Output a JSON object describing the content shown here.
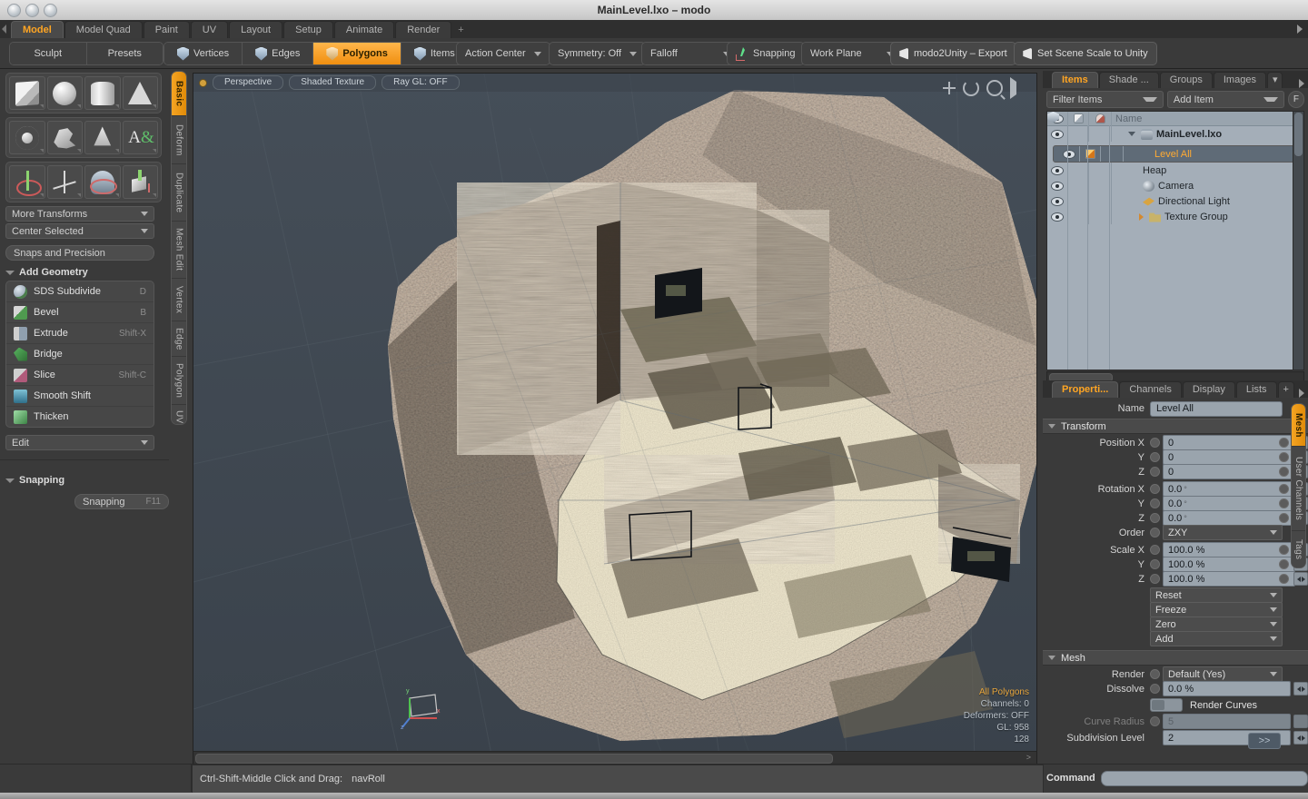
{
  "window": {
    "title": "MainLevel.lxo – modo",
    "traffic_lights": [
      "close",
      "minimize",
      "zoom"
    ]
  },
  "layout_tabs": {
    "items": [
      {
        "label": "Model",
        "active": true
      },
      {
        "label": "Model Quad",
        "active": false
      },
      {
        "label": "Paint",
        "active": false
      },
      {
        "label": "UV",
        "active": false
      },
      {
        "label": "Layout",
        "active": false
      },
      {
        "label": "Setup",
        "active": false
      },
      {
        "label": "Animate",
        "active": false
      },
      {
        "label": "Render",
        "active": false
      }
    ],
    "add_label": "+"
  },
  "toolbar": {
    "sculpt": "Sculpt",
    "presets": "Presets",
    "selection_modes": [
      {
        "label": "Vertices",
        "active": false
      },
      {
        "label": "Edges",
        "active": false
      },
      {
        "label": "Polygons",
        "active": true
      },
      {
        "label": "Items",
        "active": false
      }
    ],
    "action_center": "Action Center",
    "symmetry": "Symmetry: Off",
    "falloff": "Falloff",
    "snapping": "Snapping",
    "work_plane": "Work Plane",
    "modo2unity_export": "modo2Unity – Export",
    "set_scene_scale": "Set Scene Scale to Unity"
  },
  "left_panel": {
    "primitive_icons": [
      "cube-icon",
      "sphere-icon",
      "cylinder-icon",
      "cone-icon",
      "torus-icon",
      "spline-icon",
      "bell-curve-icon",
      "text-icon",
      "transform-gizmo-icon",
      "move-gizmo-icon",
      "rotate-gizmo-icon",
      "scale-gizmo-icon"
    ],
    "more_transforms": "More Transforms",
    "center_selected": "Center Selected",
    "snaps_and_precision": "Snaps and Precision",
    "add_geometry_header": "Add Geometry",
    "tools": [
      {
        "label": "SDS Subdivide",
        "shortcut": "D",
        "icon": "sds-subdivide-icon"
      },
      {
        "label": "Bevel",
        "shortcut": "B",
        "icon": "bevel-icon"
      },
      {
        "label": "Extrude",
        "shortcut": "Shift-X",
        "icon": "extrude-icon"
      },
      {
        "label": "Bridge",
        "shortcut": "",
        "icon": "bridge-icon"
      },
      {
        "label": "Slice",
        "shortcut": "Shift-C",
        "icon": "slice-icon"
      },
      {
        "label": "Smooth Shift",
        "shortcut": "",
        "icon": "smooth-shift-icon"
      },
      {
        "label": "Thicken",
        "shortcut": "",
        "icon": "thicken-icon"
      }
    ],
    "edit_dropdown": "Edit",
    "snapping_header": "Snapping",
    "snapping_button": "Snapping",
    "snapping_shortcut": "F11",
    "rail_tabs": [
      {
        "label": "Basic",
        "active": true
      },
      {
        "label": "Deform",
        "active": false
      },
      {
        "label": "Duplicate",
        "active": false
      },
      {
        "label": "Mesh Edit",
        "active": false
      },
      {
        "label": "Vertex",
        "active": false
      },
      {
        "label": "Edge",
        "active": false
      },
      {
        "label": "Polygon",
        "active": false
      },
      {
        "label": "UV",
        "active": false
      }
    ]
  },
  "viewport": {
    "view_mode": "Perspective",
    "shading_mode": "Shaded Texture",
    "raygl": "Ray GL: OFF",
    "controls": [
      "pan-icon",
      "rotate-icon",
      "zoom-icon",
      "play-icon"
    ],
    "info": {
      "selection": "All Polygons",
      "channels": "Channels: 0",
      "deformers": "Deformers: OFF",
      "gl": "GL: 958",
      "extra": "128"
    },
    "axis_labels": {
      "x": "x",
      "y": "y",
      "z": "z"
    }
  },
  "right_panel": {
    "top_tabs": [
      {
        "label": "Items",
        "active": true
      },
      {
        "label": "Shade ...",
        "active": false
      },
      {
        "label": "Groups",
        "active": false
      },
      {
        "label": "Images",
        "active": false
      }
    ],
    "filter_items": "Filter Items",
    "add_item": "Add Item",
    "filter_button": "F",
    "column_header_name": "Name",
    "tree": [
      {
        "name": "MainLevel.lxo",
        "indent": 0,
        "icon": "scene-icon",
        "twisty": "down",
        "selected": false
      },
      {
        "name": "Level All",
        "indent": 1,
        "icon": "mesh-icon",
        "twisty": "none",
        "selected": true
      },
      {
        "name": "Heap",
        "indent": 1,
        "icon": "mesh-icon",
        "twisty": "none",
        "selected": false
      },
      {
        "name": "Camera",
        "indent": 1,
        "icon": "camera-icon",
        "twisty": "none",
        "selected": false
      },
      {
        "name": "Directional Light",
        "indent": 1,
        "icon": "light-icon",
        "twisty": "none",
        "selected": false
      },
      {
        "name": "Texture Group",
        "indent": 1,
        "icon": "folder-icon",
        "twisty": "right",
        "selected": false
      }
    ],
    "prop_tabs": [
      {
        "label": "Properti...",
        "active": true
      },
      {
        "label": "Channels",
        "active": false
      },
      {
        "label": "Display",
        "active": false
      },
      {
        "label": "Lists",
        "active": false
      },
      {
        "label": "+",
        "active": false
      }
    ],
    "name_label": "Name",
    "name_value": "Level All",
    "transform_header": "Transform",
    "transform_rows": [
      {
        "label": "Position X",
        "value": "0",
        "unit": ""
      },
      {
        "label": "Y",
        "value": "0",
        "unit": ""
      },
      {
        "label": "Z",
        "value": "0",
        "unit": ""
      },
      {
        "label": "Rotation X",
        "value": "0.0",
        "unit": "°"
      },
      {
        "label": "Y",
        "value": "0.0",
        "unit": "°"
      },
      {
        "label": "Z",
        "value": "0.0",
        "unit": "°"
      }
    ],
    "order_label": "Order",
    "order_value": "ZXY",
    "scale_rows": [
      {
        "label": "Scale X",
        "value": "100.0 %"
      },
      {
        "label": "Y",
        "value": "100.0 %"
      },
      {
        "label": "Z",
        "value": "100.0 %"
      }
    ],
    "action_dropdowns": [
      "Reset",
      "Freeze",
      "Zero",
      "Add"
    ],
    "mesh_header": "Mesh",
    "mesh_rows": [
      {
        "label": "Render",
        "value": "Default (Yes)",
        "type": "dropdown",
        "dim": false
      },
      {
        "label": "Dissolve",
        "value": "0.0 %",
        "type": "field",
        "dim": false
      },
      {
        "label": "Curve Radius",
        "value": "5",
        "type": "field",
        "dim": true
      },
      {
        "label": "Subdivision Level",
        "value": "2",
        "type": "field",
        "dim": false
      }
    ],
    "render_curves_label": "Render Curves",
    "more_button": ">>",
    "rail_tabs": [
      {
        "label": "Mesh",
        "active": true
      },
      {
        "label": "User Channels",
        "active": false
      },
      {
        "label": "Tags",
        "active": false
      }
    ]
  },
  "status_bar": {
    "hint_keys": "Ctrl-Shift-Middle Click and Drag:",
    "hint_action": "navRoll",
    "command_label": "Command",
    "command_value": ""
  },
  "colors": {
    "accent_orange": "#ffa523",
    "panel_bg": "#3a3a3a",
    "viewport_bg": "#3f4750",
    "list_bg": "#a4aeb8",
    "field_bg": "#9aa4ad"
  }
}
